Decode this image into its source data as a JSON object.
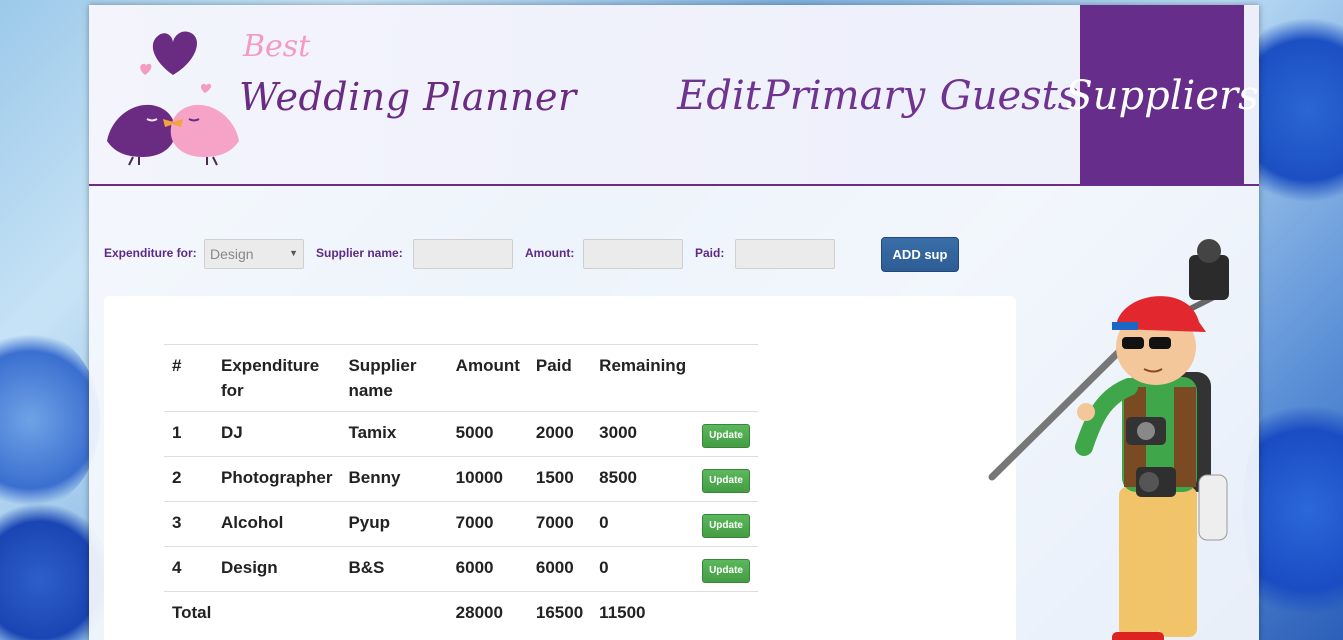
{
  "logo": {
    "tagline": "Best",
    "name": "Wedding Planner"
  },
  "nav": {
    "items": [
      {
        "label": "Edit"
      },
      {
        "label": "Primary"
      },
      {
        "label": "Guests"
      },
      {
        "label": "Suppliers",
        "active": true
      }
    ]
  },
  "form": {
    "expenditure_label": "Expenditure for:",
    "expenditure_value": "Design",
    "supplier_label": "Supplier name:",
    "amount_label": "Amount:",
    "paid_label": "Paid:",
    "add_button": "ADD sup"
  },
  "table": {
    "headers": [
      "#",
      "Expenditure for",
      "Supplier name",
      "Amount",
      "Paid",
      "Remaining"
    ],
    "rows": [
      {
        "num": "1",
        "expenditure": "DJ",
        "supplier": "Tamix",
        "amount": "5000",
        "paid": "2000",
        "remaining": "3000",
        "action": "Update"
      },
      {
        "num": "2",
        "expenditure": "Photographer",
        "supplier": "Benny",
        "amount": "10000",
        "paid": "1500",
        "remaining": "8500",
        "action": "Update"
      },
      {
        "num": "3",
        "expenditure": "Alcohol",
        "supplier": "Pyup",
        "amount": "7000",
        "paid": "7000",
        "remaining": "0",
        "action": "Update"
      },
      {
        "num": "4",
        "expenditure": "Design",
        "supplier": "B&S",
        "amount": "6000",
        "paid": "6000",
        "remaining": "0",
        "action": "Update"
      }
    ],
    "total": {
      "label": "Total",
      "amount": "28000",
      "paid": "16500",
      "remaining": "11500"
    }
  },
  "colors": {
    "brand_purple": "#662d8a",
    "add_button_blue": "#2d5d94",
    "update_green": "#449d44"
  }
}
